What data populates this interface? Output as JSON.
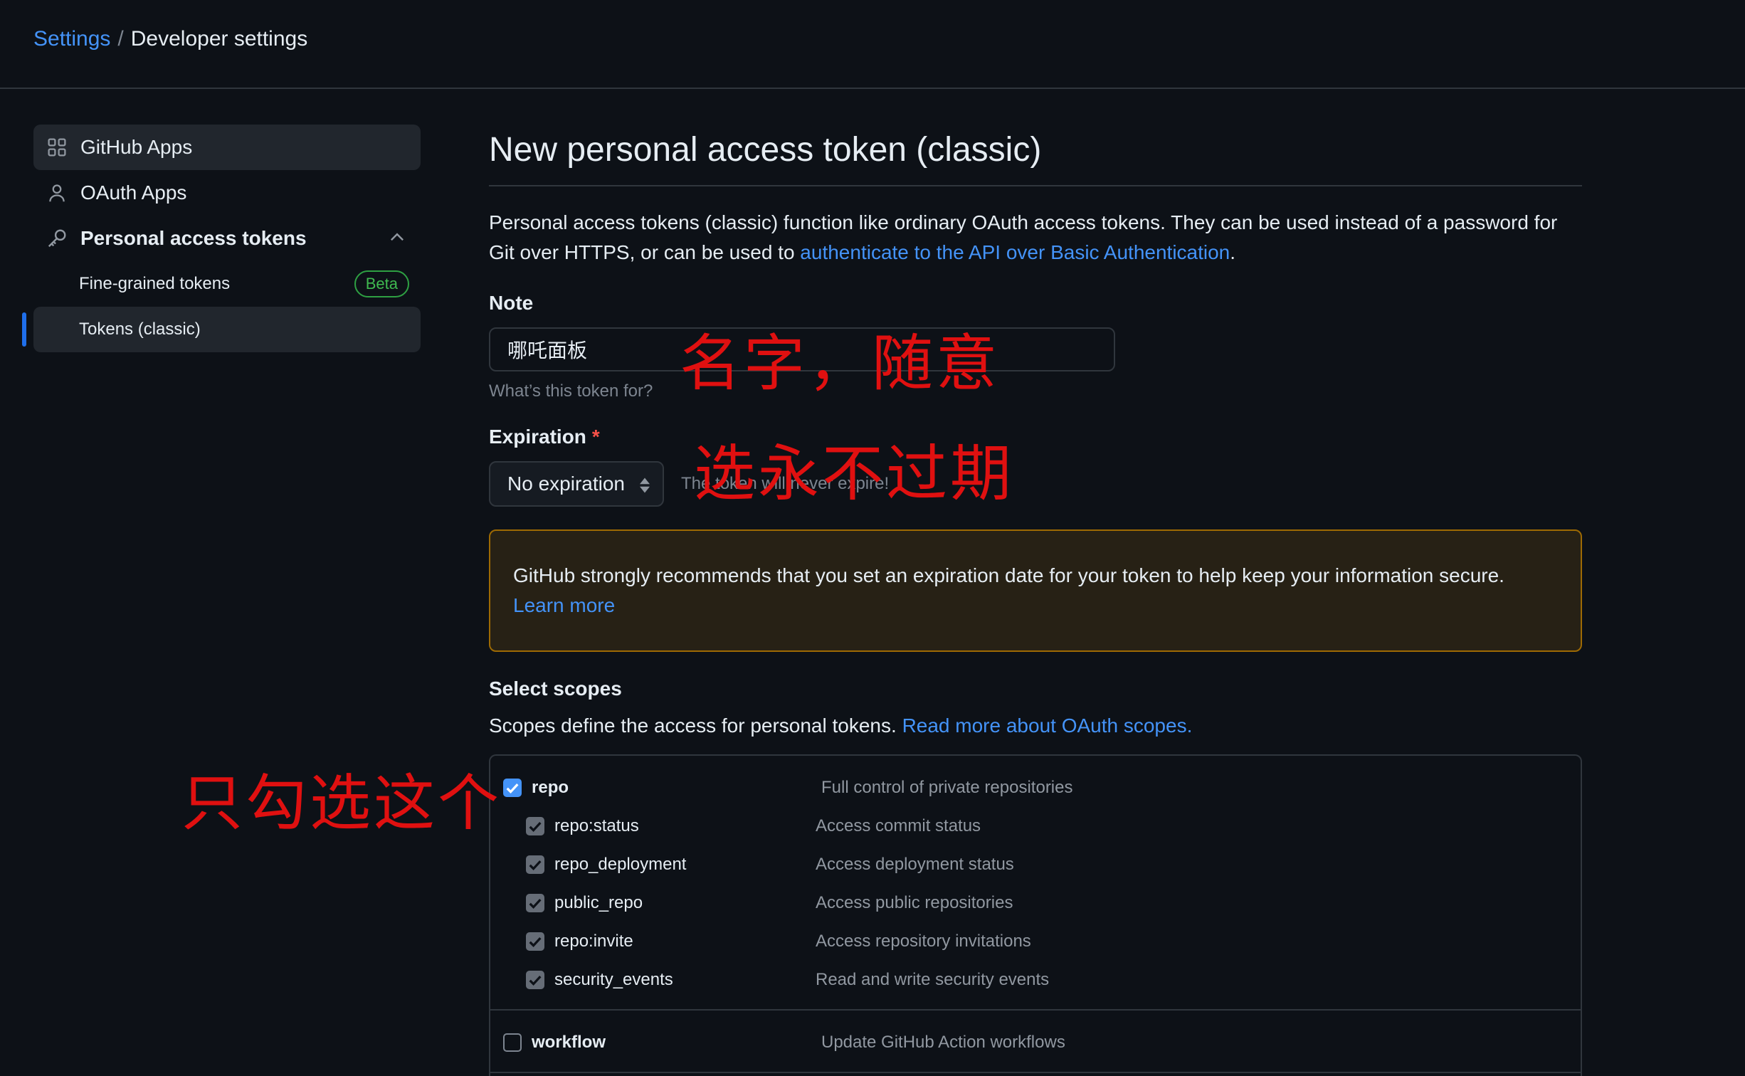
{
  "breadcrumb": {
    "parent": "Settings",
    "separator": "/",
    "current": "Developer settings"
  },
  "sidebar": {
    "items": [
      {
        "label": "GitHub Apps",
        "icon": "apps-grid-icon"
      },
      {
        "label": "OAuth Apps",
        "icon": "person-icon"
      },
      {
        "label": "Personal access tokens",
        "icon": "key-icon"
      }
    ],
    "sub_items": [
      {
        "label": "Fine-grained tokens",
        "badge": "Beta"
      },
      {
        "label": "Tokens (classic)"
      }
    ]
  },
  "main": {
    "title": "New personal access token (classic)",
    "desc_text": "Personal access tokens (classic) function like ordinary OAuth access tokens. They can be used instead of a password for Git over HTTPS, or can be used to ",
    "desc_link": "authenticate to the API over Basic Authentication",
    "desc_end": ".",
    "note_label": "Note",
    "note_value": "哪吒面板",
    "note_hint": "What’s this token for?",
    "expiration_label": "Expiration",
    "required_mark": "*",
    "expiration_value": "No expiration",
    "expiration_hint": "The token will never expire!",
    "warning_text": "GitHub strongly recommends that you set an expiration date for your token to help keep your information secure.",
    "warning_link": "Learn more",
    "scopes_title": "Select scopes",
    "scopes_desc": "Scopes define the access for personal tokens. ",
    "scopes_link": "Read more about OAuth scopes.",
    "scopes": [
      {
        "name": "repo",
        "desc": "Full control of private repositories",
        "checked": true
      },
      {
        "name": "repo:status",
        "desc": "Access commit status",
        "checked": true
      },
      {
        "name": "repo_deployment",
        "desc": "Access deployment status",
        "checked": true
      },
      {
        "name": "public_repo",
        "desc": "Access public repositories",
        "checked": true
      },
      {
        "name": "repo:invite",
        "desc": "Access repository invitations",
        "checked": true
      },
      {
        "name": "security_events",
        "desc": "Read and write security events",
        "checked": true
      },
      {
        "name": "workflow",
        "desc": "Update GitHub Action workflows",
        "checked": false
      }
    ]
  },
  "annotations": {
    "name": "名字，随意",
    "expiration": "选永不过期",
    "scope": "只勾选这个"
  },
  "colors": {
    "background": "#0d1117",
    "link": "#4493f8",
    "border": "#30363d",
    "annotation": "#e01010",
    "warning_border": "#9e6a03"
  }
}
